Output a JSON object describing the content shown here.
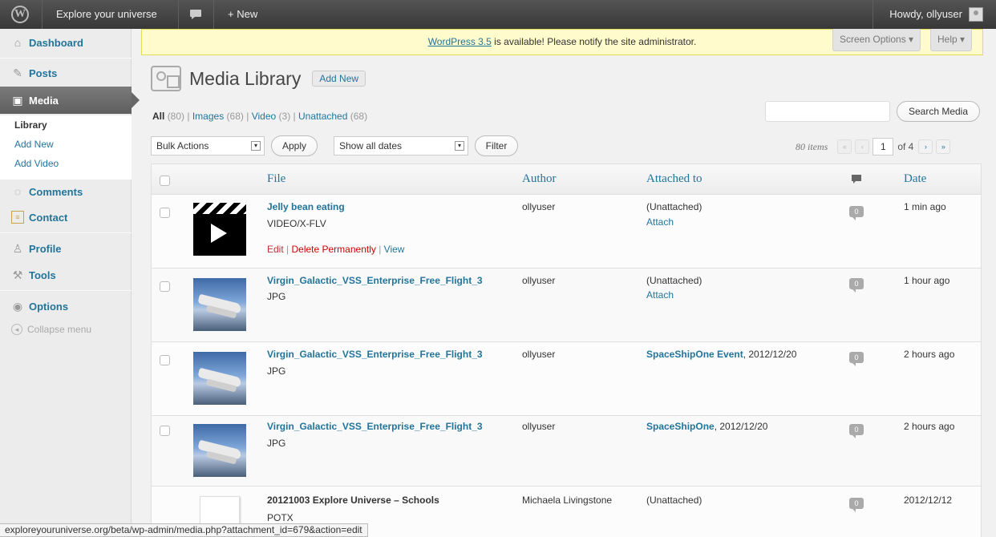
{
  "adminbar": {
    "site_name": "Explore your universe",
    "new_label": "+ New",
    "howdy": "Howdy, ollyuser"
  },
  "sidebar": {
    "items": [
      {
        "label": "Dashboard",
        "icon": "dashboard-icon"
      },
      {
        "label": "Posts",
        "icon": "pin-icon"
      },
      {
        "label": "Media",
        "icon": "media-icon"
      },
      {
        "label": "Comments",
        "icon": "comment-icon"
      },
      {
        "label": "Contact",
        "icon": "contact-icon"
      },
      {
        "label": "Profile",
        "icon": "users-icon"
      },
      {
        "label": "Tools",
        "icon": "tools-icon"
      },
      {
        "label": "Options",
        "icon": "options-icon"
      }
    ],
    "submenu": [
      "Library",
      "Add New",
      "Add Video"
    ],
    "collapse": "Collapse menu"
  },
  "notice": {
    "link": "WordPress 3.5",
    "text": " is available! Please notify the site administrator."
  },
  "screen_options": "Screen Options ▾",
  "help": "Help ▾",
  "page": {
    "title": "Media Library",
    "add_new": "Add New"
  },
  "filters": {
    "all": "All",
    "all_count": "(80)",
    "images": "Images",
    "images_count": "(68)",
    "video": "Video",
    "video_count": "(3)",
    "unattached": "Unattached",
    "unattached_count": "(68)",
    "sep": "|"
  },
  "search": {
    "value": "",
    "button": "Search Media"
  },
  "bulk": {
    "actions": "Bulk Actions",
    "apply": "Apply",
    "dates": "Show all dates",
    "filter": "Filter"
  },
  "pagination": {
    "items": "80 items",
    "first": "«",
    "prev": "‹",
    "current": "1",
    "of": "of 4",
    "next": "›",
    "last": "»"
  },
  "table": {
    "headers": {
      "file": "File",
      "author": "Author",
      "attached": "Attached to",
      "date": "Date"
    },
    "rows": [
      {
        "name": "Jelly bean eating",
        "type": "VIDEO/X-FLV",
        "author": "ollyuser",
        "attached": "(Unattached)",
        "attach": "Attach",
        "comments": "0",
        "date": "1 min ago",
        "actions": {
          "edit": "Edit",
          "delete": "Delete Permanently",
          "view": "View",
          "sep": " | "
        }
      },
      {
        "name": "Virgin_Galactic_VSS_Enterprise_Free_Flight_3",
        "type": "JPG",
        "author": "ollyuser",
        "attached": "(Unattached)",
        "attach": "Attach",
        "comments": "0",
        "date": "1 hour ago"
      },
      {
        "name": "Virgin_Galactic_VSS_Enterprise_Free_Flight_3",
        "type": "JPG",
        "author": "ollyuser",
        "attached_link": "SpaceShipOne Event",
        "attached_date": ", 2012/12/20",
        "comments": "0",
        "date": "2 hours ago"
      },
      {
        "name": "Virgin_Galactic_VSS_Enterprise_Free_Flight_3",
        "type": "JPG",
        "author": "ollyuser",
        "attached_link": "SpaceShipOne",
        "attached_date": ", 2012/12/20",
        "comments": "0",
        "date": "2 hours ago"
      },
      {
        "name": "20121003 Explore Universe – Schools",
        "type": "POTX",
        "author": "Michaela Livingstone",
        "attached": "(Unattached)",
        "comments": "0",
        "date": "2012/12/12"
      }
    ]
  },
  "statusbar": "exploreyouruniverse.org/beta/wp-admin/media.php?attachment_id=679&action=edit"
}
